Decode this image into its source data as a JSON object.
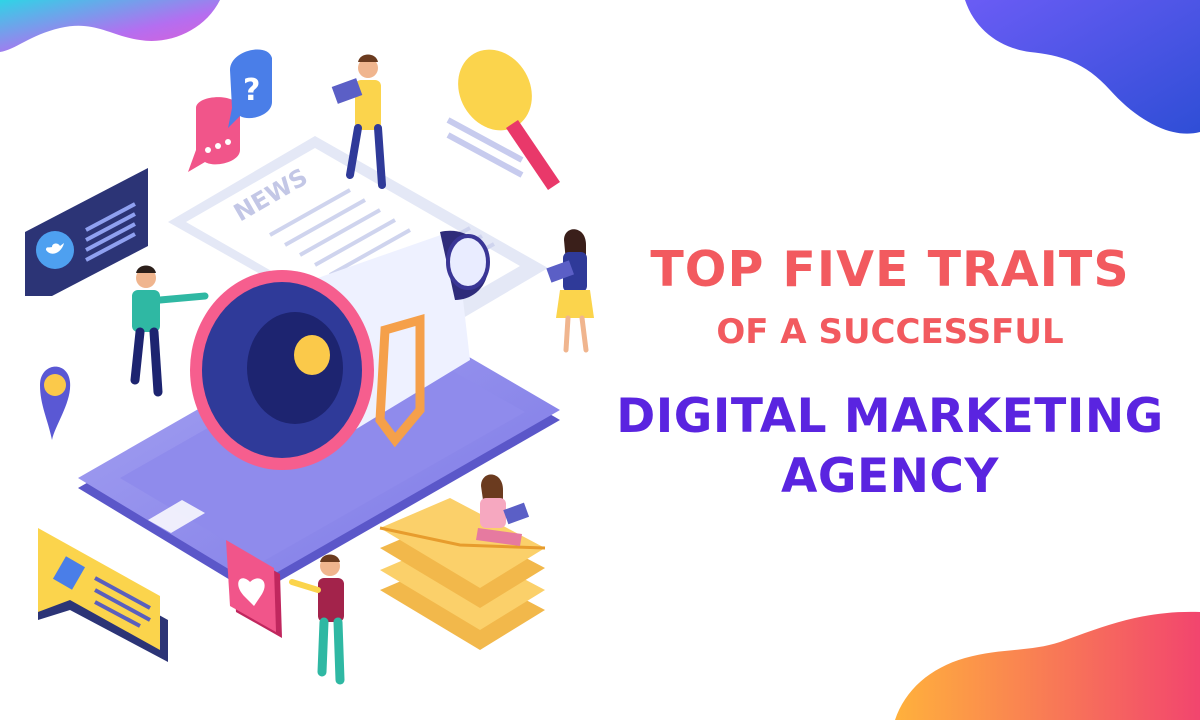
{
  "headline": {
    "line1": "TOP FIVE TRAITS",
    "line2": "OF A SUCCESSFUL",
    "line3": "DIGITAL MARKETING",
    "line4": "AGENCY"
  },
  "illustration": {
    "newspaper_text": "NEWS",
    "question_mark": "?"
  },
  "colors": {
    "headline_top": "#f25a5f",
    "headline_bottom": "#5a24e0",
    "blob_cyan": "#2fd4e6",
    "blob_blue": "#3a4fe0",
    "blob_orange": "#ff9a3c",
    "blob_pink": "#f34f72"
  },
  "icons": [
    "chat-bubble-icon",
    "question-bubble-icon",
    "twitter-chat-icon",
    "location-pin-icon",
    "thumbs-up-chat-icon",
    "heart-card-icon",
    "magnifier-icon",
    "megaphone-icon",
    "envelope-stack-icon"
  ]
}
